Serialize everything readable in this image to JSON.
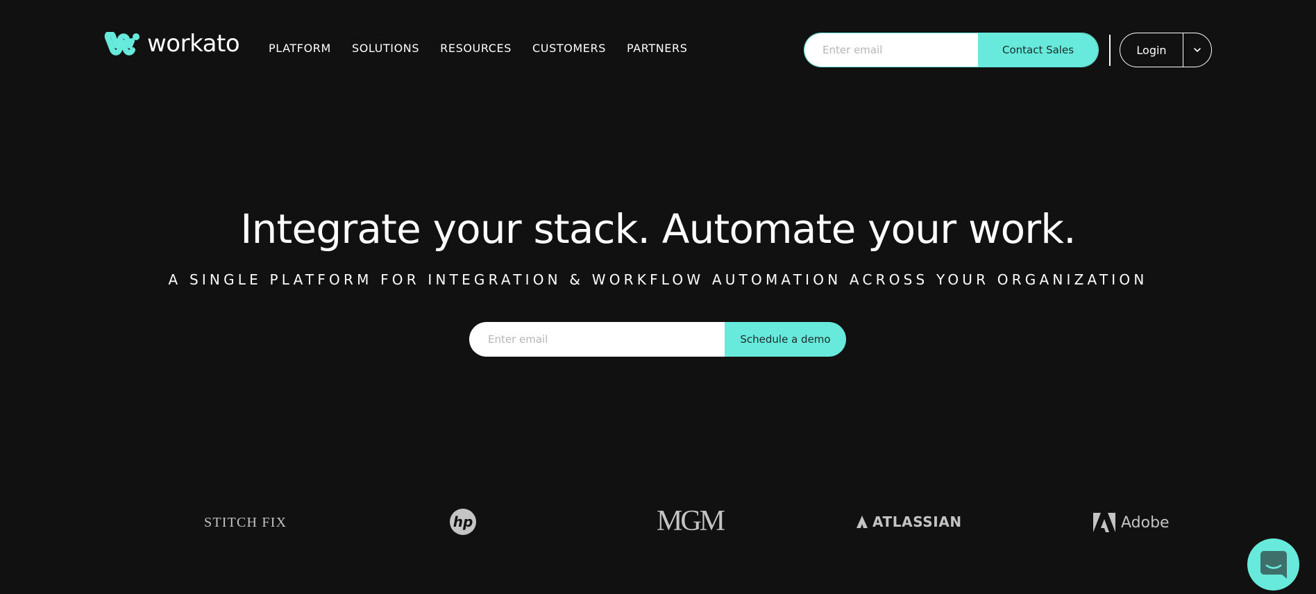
{
  "brand": {
    "name": "workato",
    "logo_icon": "workato-w-icon",
    "accent_color": "#67e9dc",
    "background_color": "#111111"
  },
  "header": {
    "nav": [
      {
        "label": "PLATFORM"
      },
      {
        "label": "SOLUTIONS"
      },
      {
        "label": "RESOURCES"
      },
      {
        "label": "CUSTOMERS"
      },
      {
        "label": "PARTNERS"
      }
    ],
    "email_input": {
      "placeholder": "Enter email",
      "value": ""
    },
    "contact_sales_label": "Contact Sales",
    "login_label": "Login",
    "login_menu_icon": "chevron-down-icon"
  },
  "hero": {
    "title": "Integrate your stack. Automate your work.",
    "subtitle": "A SINGLE PLATFORM FOR INTEGRATION & WORKFLOW AUTOMATION ACROSS YOUR ORGANIZATION",
    "email_input": {
      "placeholder": "Enter email",
      "value": ""
    },
    "cta_label": "Schedule a demo"
  },
  "customer_logos": [
    {
      "name": "STITCH FIX"
    },
    {
      "name": "hp"
    },
    {
      "name": "MGM"
    },
    {
      "name": "ATLASSIAN"
    },
    {
      "name": "Adobe"
    }
  ],
  "chat_launcher": {
    "icon": "chat-bubble-icon"
  }
}
